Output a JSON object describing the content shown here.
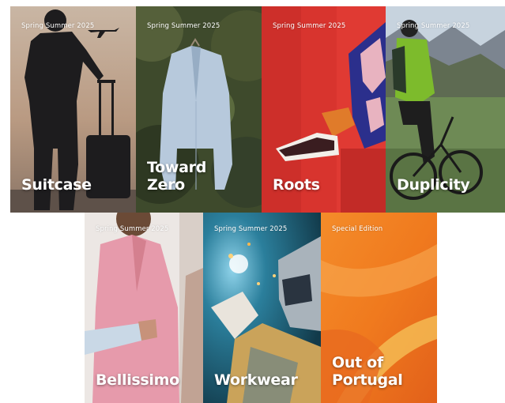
{
  "magazines": [
    {
      "season": "Spring Summer 2025",
      "title": "Suitcase"
    },
    {
      "season": "Spring Summer 2025",
      "title": "Toward\nZero"
    },
    {
      "season": "Spring Summer 2025",
      "title": "Roots"
    },
    {
      "season": "Spring Summer 2025",
      "title": "Duplicity"
    },
    {
      "season": "Spring Summer 2025",
      "title": "Bellissimo"
    },
    {
      "season": "Spring Summer 2025",
      "title": "Workwear"
    },
    {
      "season": "Special Edition",
      "title": "Out of\nPortugal"
    }
  ],
  "colors": {
    "text": "#ffffff",
    "suitcase_bg": "#bfa28a",
    "toward_zero_bg": "#3e4a2c",
    "roots_bg": "#d8342e",
    "duplicity_bg": "#6e8a55",
    "bellissimo_bg": "#ece7e4",
    "workwear_bg": "#1d5267",
    "portugal_bg": "#f07a1e"
  }
}
